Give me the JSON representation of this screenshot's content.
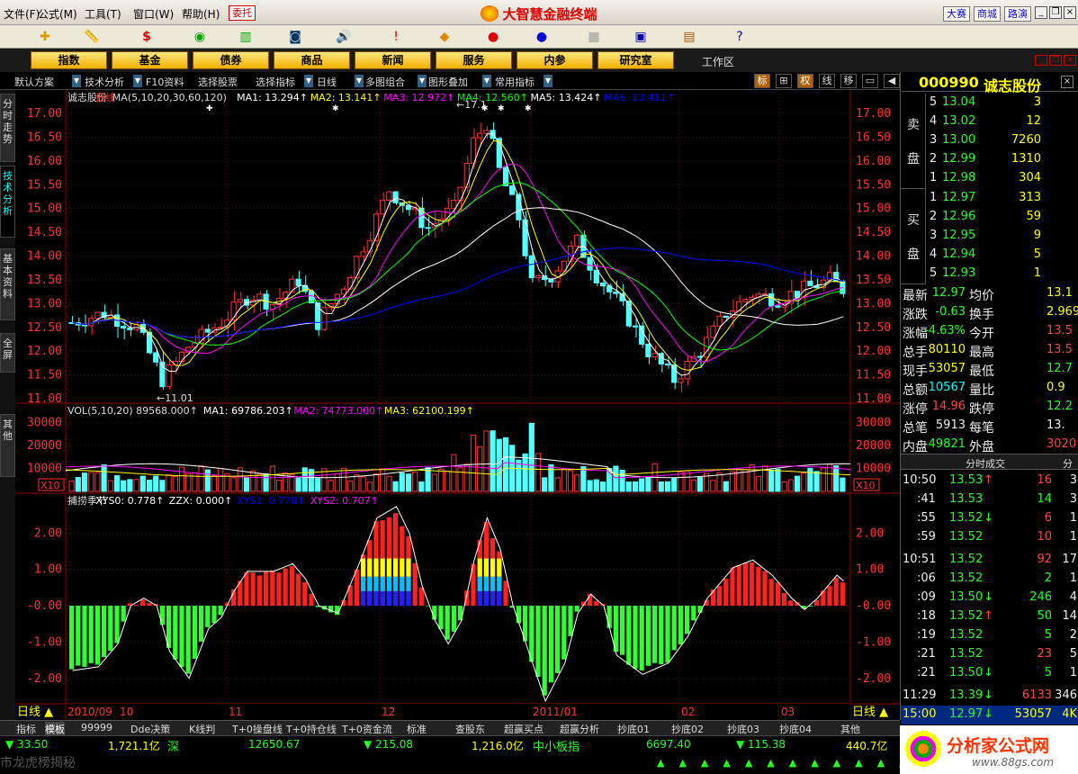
{
  "menu": {
    "items": [
      "文件(F)",
      "公式(M)",
      "工具(T)",
      "窗口(W)",
      "帮助(H)"
    ],
    "entrust": "委托",
    "title": "大智慧金融终端",
    "buttons": [
      "大赛",
      "商城",
      "路演"
    ]
  },
  "nav": {
    "buttons": [
      "指数",
      "基金",
      "债券",
      "商品",
      "新闻",
      "服务",
      "内参",
      "研究室"
    ],
    "workarea": "工作区"
  },
  "tabs": {
    "options": [
      "默认方案",
      "技术分析",
      "F10资料",
      "选择股票",
      "选择指标",
      "日线",
      "多图组合",
      "图形叠加",
      "常用指标"
    ],
    "small": [
      "标",
      "⊞",
      "权",
      "线",
      "移"
    ]
  },
  "sidetabs": [
    "分时走势",
    "技术分析",
    "基本资料",
    "全屏",
    "其他"
  ],
  "stock": {
    "code": "000990",
    "name": "诚志股份"
  },
  "main_legend": {
    "name": "诚志股份",
    "period": "日线",
    "params": "MA(5,10,20,30,60,120)",
    "ma": [
      {
        "label": "MA1: 13.294",
        "color": "#ffffff"
      },
      {
        "label": "MA2: 13.141",
        "color": "#ffff00"
      },
      {
        "label": "MA3: 12.972",
        "color": "#ff00ff"
      },
      {
        "label": "MA4: 12.560",
        "color": "#00ff00"
      },
      {
        "label": "MA5: 13.424",
        "color": "#ffffff"
      },
      {
        "label": "MA6: 13.411",
        "color": "#0000ff"
      }
    ]
  },
  "vol_legend": {
    "params": "VOL(5,10,20) 89568.000",
    "ma": [
      {
        "label": "MA1: 69786.203",
        "color": "#ffffff"
      },
      {
        "label": "MA2: 74773.000",
        "color": "#ff00ff"
      },
      {
        "label": "MA3: 62100.199",
        "color": "#ffff00"
      }
    ]
  },
  "ind_legend": {
    "name": "捕捞季节",
    "items": [
      {
        "label": "XYS0: 0.778",
        "color": "#ffffff"
      },
      {
        "label": "ZZX: 0.000",
        "color": "#ffffff"
      },
      {
        "label": "XYS1: 0.778",
        "color": "#0000ff"
      },
      {
        "label": "XYS2: 0.707",
        "color": "#ff00ff"
      }
    ]
  },
  "price_axis": [
    "17.00",
    "16.50",
    "16.00",
    "15.50",
    "15.00",
    "14.50",
    "14.00",
    "13.50",
    "13.00",
    "12.50",
    "12.00",
    "11.50",
    "11.00"
  ],
  "vol_axis": [
    "30000",
    "20000",
    "10000"
  ],
  "vol_unit": "X10",
  "ind_axis": [
    "2.00",
    "1.00",
    "-0.00",
    "-1.00",
    "-2.00"
  ],
  "annotations": {
    "high": "17.1",
    "low": "11.01"
  },
  "date_labels": [
    "2010/09",
    "10",
    "11",
    "12",
    "2011/01",
    "02",
    "03"
  ],
  "period_label": "日线",
  "orderbook": {
    "sell_label": [
      "卖",
      "盘"
    ],
    "buy_label": [
      "买",
      "盘"
    ],
    "sell": [
      {
        "n": "5",
        "p": "13.04",
        "v": "3"
      },
      {
        "n": "4",
        "p": "13.02",
        "v": "12"
      },
      {
        "n": "3",
        "p": "13.00",
        "v": "7260"
      },
      {
        "n": "2",
        "p": "12.99",
        "v": "1310"
      },
      {
        "n": "1",
        "p": "12.98",
        "v": "304"
      }
    ],
    "buy": [
      {
        "n": "1",
        "p": "12.97",
        "v": "313"
      },
      {
        "n": "2",
        "p": "12.96",
        "v": "59"
      },
      {
        "n": "3",
        "p": "12.95",
        "v": "9"
      },
      {
        "n": "4",
        "p": "12.94",
        "v": "5"
      },
      {
        "n": "5",
        "p": "12.93",
        "v": "1"
      }
    ]
  },
  "quote": [
    {
      "l1": "最新",
      "v1": "12.97",
      "c1": "#2f2",
      "l2": "均价",
      "v2": "13.1",
      "c2": "#ff0"
    },
    {
      "l1": "涨跌",
      "v1": "-0.63",
      "c1": "#2f2",
      "l2": "换手",
      "v2": "2.969",
      "c2": "#ff0"
    },
    {
      "l1": "涨幅",
      "v1": "-4.63%",
      "c1": "#2f2",
      "l2": "今开",
      "v2": "13.5",
      "c2": "#f44"
    },
    {
      "l1": "总手",
      "v1": "80110",
      "c1": "#ff0",
      "l2": "最高",
      "v2": "13.5",
      "c2": "#f44"
    },
    {
      "l1": "现手",
      "v1": "53057",
      "c1": "#ff0",
      "l2": "最低",
      "v2": "12.7",
      "c2": "#2f2"
    },
    {
      "l1": "总额",
      "v1": "10567",
      "c1": "#0ff",
      "l2": "量比",
      "v2": "0.9",
      "c2": "#ff0"
    },
    {
      "l1": "涨停",
      "v1": "14.96",
      "c1": "#f44",
      "l2": "跌停",
      "v2": "12.2",
      "c2": "#2f2"
    },
    {
      "l1": "总笔",
      "v1": "5913",
      "c1": "#eee",
      "l2": "每笔",
      "v2": "13.",
      "c2": "#eee"
    },
    {
      "l1": "内盘",
      "v1": "49821",
      "c1": "#2f2",
      "l2": "外盘",
      "v2": "3020",
      "c2": "#f44"
    }
  ],
  "ticks_header": {
    "title": "分时成交",
    "tab": "分"
  },
  "ticks": [
    {
      "t": "10:50",
      "p": "13.53",
      "a": "↑",
      "pc": "#2f2",
      "ac": "#f44",
      "v": "16",
      "vc": "#f44",
      "n": "3"
    },
    {
      "t": ":41",
      "p": "13.53",
      "a": "",
      "pc": "#2f2",
      "ac": "#2f2",
      "v": "14",
      "vc": "#2f2",
      "n": "3"
    },
    {
      "t": ":55",
      "p": "13.52",
      "a": "↓",
      "pc": "#2f2",
      "ac": "#2f2",
      "v": "6",
      "vc": "#f44",
      "n": "1"
    },
    {
      "t": ":59",
      "p": "13.52",
      "a": "",
      "pc": "#2f2",
      "ac": "#2f2",
      "v": "10",
      "vc": "#f44",
      "n": "1"
    },
    {
      "t": "10:51",
      "p": "13.52",
      "a": "",
      "pc": "#2f2",
      "ac": "#2f2",
      "v": "92",
      "vc": "#f44",
      "n": "17"
    },
    {
      "t": ":06",
      "p": "13.52",
      "a": "",
      "pc": "#2f2",
      "ac": "#2f2",
      "v": "2",
      "vc": "#2f2",
      "n": "1"
    },
    {
      "t": ":09",
      "p": "13.50",
      "a": "↓",
      "pc": "#2f2",
      "ac": "#2f2",
      "v": "246",
      "vc": "#2f2",
      "n": "4"
    },
    {
      "t": ":18",
      "p": "13.52",
      "a": "↑",
      "pc": "#2f2",
      "ac": "#f44",
      "v": "50",
      "vc": "#2f2",
      "n": "14"
    },
    {
      "t": ":19",
      "p": "13.52",
      "a": "",
      "pc": "#2f2",
      "ac": "#2f2",
      "v": "5",
      "vc": "#2f2",
      "n": "2"
    },
    {
      "t": ":21",
      "p": "13.52",
      "a": "",
      "pc": "#2f2",
      "ac": "#2f2",
      "v": "23",
      "vc": "#f44",
      "n": "5"
    },
    {
      "t": ":21",
      "p": "13.50",
      "a": "↓",
      "pc": "#2f2",
      "ac": "#2f2",
      "v": "5",
      "vc": "#2f2",
      "n": "1"
    },
    {
      "t": "11:29",
      "p": "13.39",
      "a": "↓",
      "pc": "#2f2",
      "ac": "#2f2",
      "v": "6133",
      "vc": "#f44",
      "n": "346"
    },
    {
      "t": "15:00",
      "p": "12.97",
      "a": "↓",
      "pc": "#2f2",
      "ac": "#2f2",
      "v": "53057",
      "vc": "#ff0",
      "n": "4K"
    }
  ],
  "bottom_tabs": [
    "指标",
    "模板",
    "99999",
    "Dde决策",
    "K线判",
    "T+0操盘线",
    "T+0持仓线",
    "T+0资金流",
    "标准",
    "查股东",
    "超赢买点",
    "超赢分析",
    "抄底01",
    "抄底02",
    "抄底03",
    "抄底04",
    "其他"
  ],
  "status": {
    "s1": "▼ 33.50",
    "s2": "1,721.1亿",
    "s3": "深",
    "s4": "12650.67",
    "s5": "▼ 215.08",
    "s6": "1,216.0亿",
    "s7": "中小板指",
    "s8": "6697.40",
    "s9": "▼ 115.38",
    "s10": "440.7亿",
    "ticker": "市龙虎榜揭秘"
  },
  "brand": {
    "name": "分析家公式网",
    "url": "www.88gs.com"
  },
  "colors": {
    "up": "#ff3232",
    "down": "#54ffff",
    "grid": "#8b0000"
  }
}
